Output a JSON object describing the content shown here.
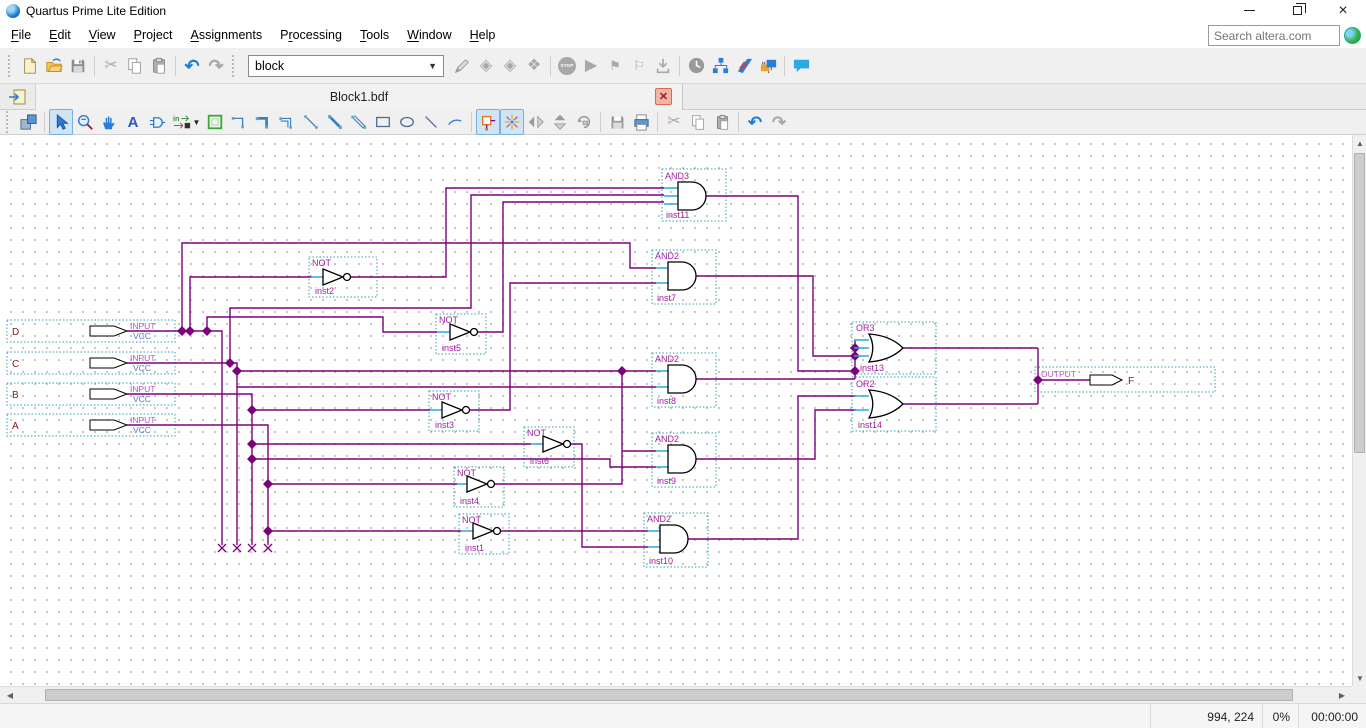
{
  "window": {
    "title": "Quartus Prime Lite Edition",
    "controls": [
      "minimize-icon",
      "restore-icon",
      "close-icon"
    ]
  },
  "menu": {
    "items": [
      {
        "label": "File",
        "mnemonic": 0
      },
      {
        "label": "Edit",
        "mnemonic": 0
      },
      {
        "label": "View",
        "mnemonic": 0
      },
      {
        "label": "Project",
        "mnemonic": 0
      },
      {
        "label": "Assignments",
        "mnemonic": 0
      },
      {
        "label": "Processing",
        "mnemonic": 1
      },
      {
        "label": "Tools",
        "mnemonic": 0
      },
      {
        "label": "Window",
        "mnemonic": 0
      },
      {
        "label": "Help",
        "mnemonic": 0
      }
    ]
  },
  "search": {
    "placeholder": "Search altera.com",
    "icon": "globe-icon"
  },
  "toolbar1": {
    "combo_value": "block",
    "icons": [
      "new",
      "open",
      "save",
      "cut",
      "copy",
      "paste",
      "undo",
      "redo",
      "pencil-edit",
      "compile-a",
      "compile-b",
      "compile-c",
      "stop",
      "start-compilation",
      "start-analysis",
      "start-timing",
      "export-device",
      "timing-analyzer",
      "netlist-viewer",
      "assignment-editor",
      "programmer",
      "chat"
    ]
  },
  "toolbar2": {
    "icons": [
      "attach-window",
      "selection-tool",
      "zoom-tool",
      "hand-tool",
      "text-tool",
      "symbol-tool",
      "pin-tool",
      "block-tool",
      "orthogonal-node",
      "orthogonal-bus",
      "orthogonal-conduit",
      "diagonal-node",
      "diagonal-bus",
      "diagonal-conduit",
      "rectangle-tool",
      "ellipse-tool",
      "line-tool",
      "arc-tool",
      "rubberbanding",
      "partial-line-select",
      "flip-horizontal",
      "flip-vertical",
      "rotate-left",
      "save",
      "print",
      "cut",
      "copy",
      "paste",
      "undo",
      "redo"
    ],
    "selected": [
      "selection-tool",
      "rubberbanding",
      "partial-line-select"
    ]
  },
  "tab": {
    "title": "Block1.bdf"
  },
  "schematic": {
    "inputs": [
      {
        "pin": "D",
        "type": "INPUT",
        "value": "VCC"
      },
      {
        "pin": "C",
        "type": "INPUT",
        "value": "VCC"
      },
      {
        "pin": "B",
        "type": "INPUT",
        "value": "VCC"
      },
      {
        "pin": "A",
        "type": "INPUT",
        "value": "VCC"
      }
    ],
    "gates": [
      {
        "type": "AND3",
        "name": "inst11"
      },
      {
        "type": "NOT",
        "name": "inst2"
      },
      {
        "type": "NOT",
        "name": "inst5"
      },
      {
        "type": "NOT",
        "name": "inst3"
      },
      {
        "type": "NOT",
        "name": "inst6"
      },
      {
        "type": "NOT",
        "name": "inst4"
      },
      {
        "type": "NOT",
        "name": "inst1"
      },
      {
        "type": "AND2",
        "name": "inst7"
      },
      {
        "type": "AND2",
        "name": "inst8"
      },
      {
        "type": "AND2",
        "name": "inst9"
      },
      {
        "type": "AND2",
        "name": "inst10"
      },
      {
        "type": "OR3",
        "name": "inst13"
      },
      {
        "type": "OR2",
        "name": "inst14"
      }
    ],
    "output": {
      "pin": "F",
      "type": "OUTPUT"
    },
    "colors": {
      "wire": "#7D007D",
      "pin_stub": "#2FA8DC",
      "selection_box": "#2AA0A8",
      "gate_label": "#A020A0",
      "pin_name": "#7A1F1F",
      "input_label": "#BB55BB",
      "vcc_label": "#5577CC"
    }
  },
  "statusbar": {
    "coords": "994, 224",
    "progress": "0%",
    "time": "00:00:00"
  }
}
